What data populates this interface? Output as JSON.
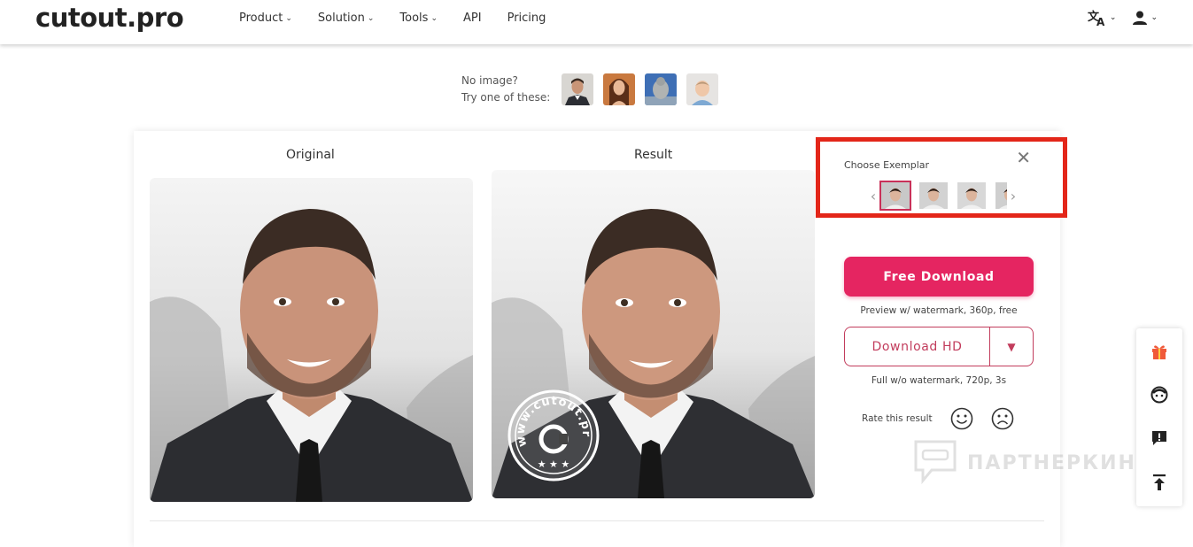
{
  "header": {
    "logo": "cutout.pro",
    "nav": [
      {
        "label": "Product",
        "dropdown": true
      },
      {
        "label": "Solution",
        "dropdown": true
      },
      {
        "label": "Tools",
        "dropdown": true
      },
      {
        "label": "API",
        "dropdown": false
      },
      {
        "label": "Pricing",
        "dropdown": false
      }
    ],
    "icons": [
      "translate-icon",
      "user-icon"
    ]
  },
  "samples": {
    "line1": "No image?",
    "line2": "Try one of these:",
    "thumbs": [
      "sample-man-suit",
      "sample-woman",
      "sample-statue",
      "sample-baby"
    ]
  },
  "main": {
    "original_label": "Original",
    "result_label": "Result",
    "watermark_stamp": "www.cutout.pro"
  },
  "exemplar": {
    "title": "Choose Exemplar",
    "count_visible": 4
  },
  "actions": {
    "free_download": "Free Download",
    "free_note": "Preview w/ watermark, 360p, free",
    "download_hd": "Download HD",
    "hd_note": "Full w/o watermark, 720p, 3s",
    "rate_label": "Rate this result"
  },
  "side_tools": [
    "gift-icon",
    "face-support-icon",
    "feedback-icon",
    "back-to-top-icon"
  ],
  "overlay_watermark": "ПАРТНЕРКИН",
  "colors": {
    "primary": "#e52561",
    "outline": "#c23c5c",
    "highlight_box": "#e32619"
  }
}
